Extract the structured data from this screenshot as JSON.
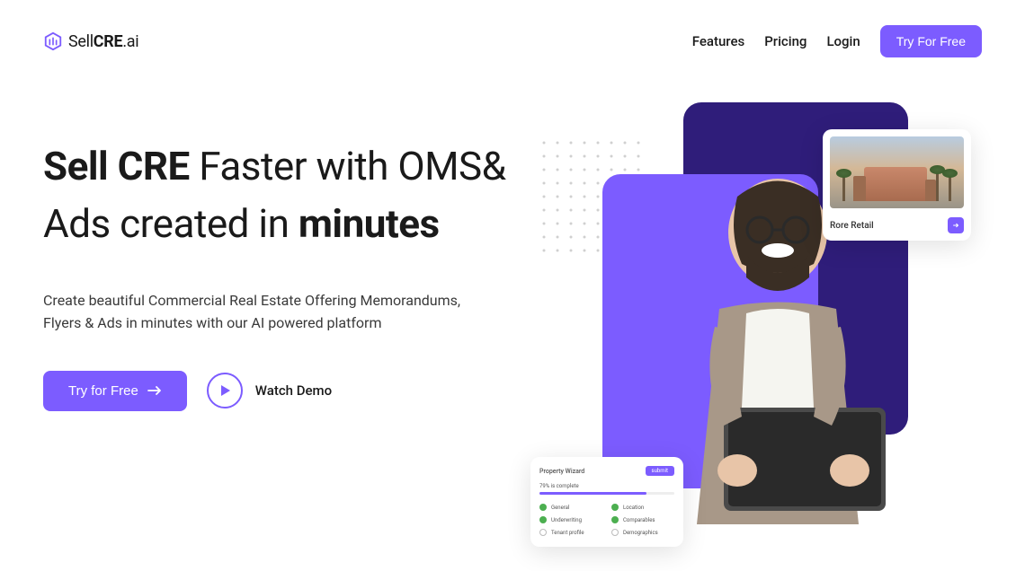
{
  "brand": {
    "prefix": "Sell",
    "bold": "CRE",
    "suffix": ".ai"
  },
  "nav": {
    "features": "Features",
    "pricing": "Pricing",
    "login": "Login",
    "cta": "Try For Free"
  },
  "hero": {
    "h_bold1": "Sell CRE",
    "h_rest1": " Faster with OMS& Ads created in ",
    "h_bold2": "minutes",
    "sub": "Create beautiful Commercial Real Estate Offering Memorandums, Flyers & Ads in minutes with our AI powered platform",
    "cta": "Try for Free",
    "watch": "Watch Demo"
  },
  "retail_card": {
    "label": "Rore Retail"
  },
  "wizard": {
    "title": "Property Wizard",
    "badge": "submit",
    "progress_label": "79% is complete",
    "items": [
      {
        "label": "General",
        "done": true
      },
      {
        "label": "Location",
        "done": true
      },
      {
        "label": "Underwriting",
        "done": true
      },
      {
        "label": "Comparables",
        "done": true
      },
      {
        "label": "Tenant profile",
        "done": false
      },
      {
        "label": "Demographics",
        "done": false
      }
    ]
  }
}
